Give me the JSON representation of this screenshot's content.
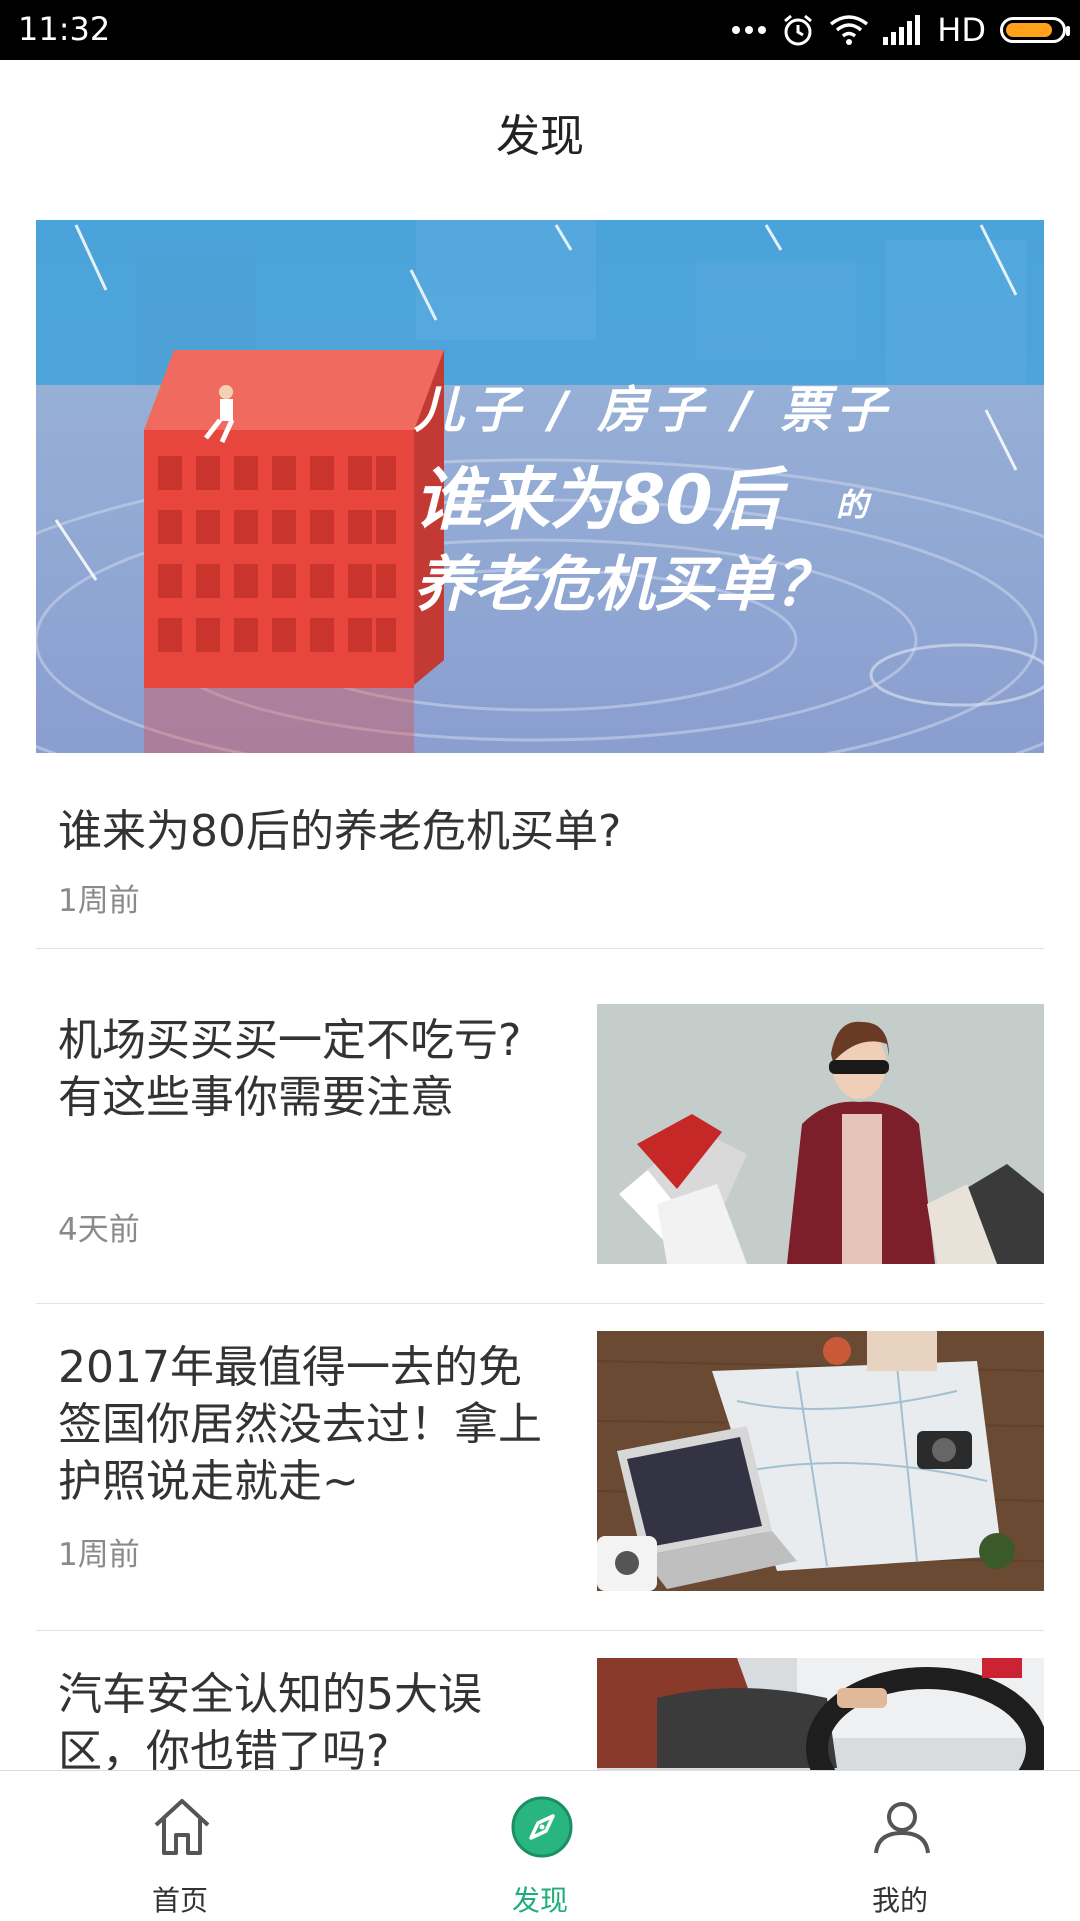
{
  "status_bar": {
    "time": "11:32",
    "network": "HD",
    "battery_level": 0.85
  },
  "header": {
    "title": "发现"
  },
  "hero": {
    "banner_lines": [
      "儿子 / 房子 / 票子",
      "谁来为80后",
      "的",
      "养老危机买单？"
    ],
    "title": "谁来为80后的养老危机买单?",
    "time": "1周前"
  },
  "articles": [
    {
      "title": "机场买买买一定不吃亏? 有这些事你需要注意",
      "time": "4天前",
      "image": "shopping-woman-photo"
    },
    {
      "title": "2017年最值得一去的免签国你居然没去过！拿上护照说走就走~",
      "time": "1周前",
      "image": "travel-map-laptop-photo"
    },
    {
      "title": "汽车安全认知的5大误区，你也错了吗?",
      "time": "",
      "image": "driving-car-photo"
    }
  ],
  "tabbar": {
    "items": [
      {
        "label": "首页",
        "icon": "home-icon",
        "active": false
      },
      {
        "label": "发现",
        "icon": "compass-icon",
        "active": true
      },
      {
        "label": "我的",
        "icon": "user-icon",
        "active": false
      }
    ]
  },
  "colors": {
    "accent": "#1fae7a",
    "banner_sky": "#4aa3da",
    "building_red": "#e8453c"
  }
}
